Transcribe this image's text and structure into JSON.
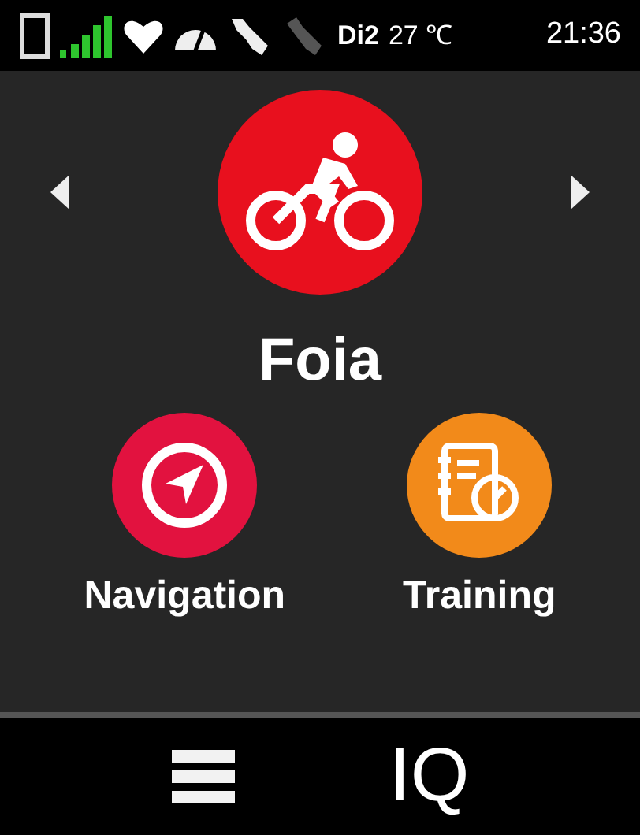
{
  "status_bar": {
    "shifting_label": "Di2",
    "temperature": "27 ℃",
    "time": "21:36"
  },
  "profile": {
    "name": "Foia"
  },
  "apps": [
    {
      "label": "Navigation",
      "color": "#e2123f",
      "kind": "navigation"
    },
    {
      "label": "Training",
      "color": "#f28a1a",
      "kind": "training"
    }
  ],
  "bottom_bar": {
    "connect_iq_label": "IQ"
  }
}
